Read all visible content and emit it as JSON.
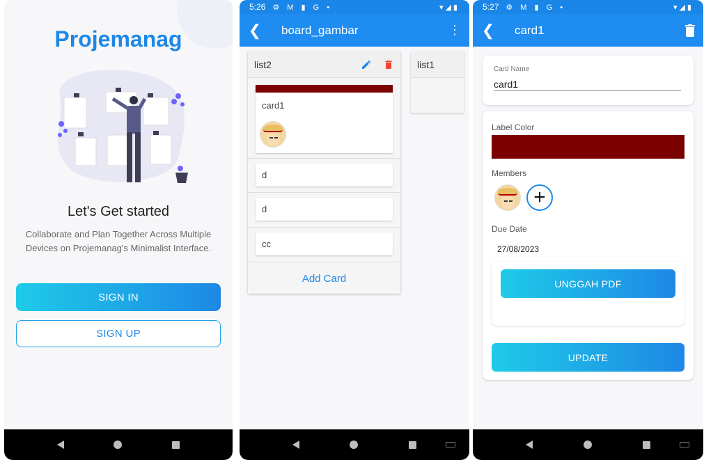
{
  "screen1": {
    "app_title": "Projemanag",
    "heading": "Let's Get started",
    "description": "Collaborate and Plan Together Across Multiple Devices on Projemanag's Minimalist Interface.",
    "sign_in_label": "SIGN IN",
    "sign_up_label": "SIGN UP"
  },
  "screen2": {
    "status_time": "5:26",
    "status_icons": "⚙ M ▮ G •",
    "toolbar_title": "board_gambar",
    "list1": {
      "name": "list2",
      "cards": [
        {
          "name": "card1",
          "label_color": "#7b0000",
          "has_member": true
        },
        {
          "name": "d"
        },
        {
          "name": "d"
        },
        {
          "name": "cc"
        }
      ],
      "add_card_label": "Add Card"
    },
    "list2": {
      "name": "list1"
    }
  },
  "screen3": {
    "status_time": "5:27",
    "status_icons": "⚙ M ▮ G •",
    "toolbar_title": "card1",
    "card_name_label": "Card Name",
    "card_name_value": "card1",
    "label_color_label": "Label Color",
    "label_color": "#7b0000",
    "members_label": "Members",
    "due_date_label": "Due Date",
    "due_date_value": "27/08/2023",
    "upload_label": "UNGGAH PDF",
    "update_label": "UPDATE"
  },
  "colors": {
    "primary": "#1e88e5",
    "gradient_start": "#1ecbe8",
    "label_red": "#7b0000",
    "delete_red": "#f44336"
  }
}
